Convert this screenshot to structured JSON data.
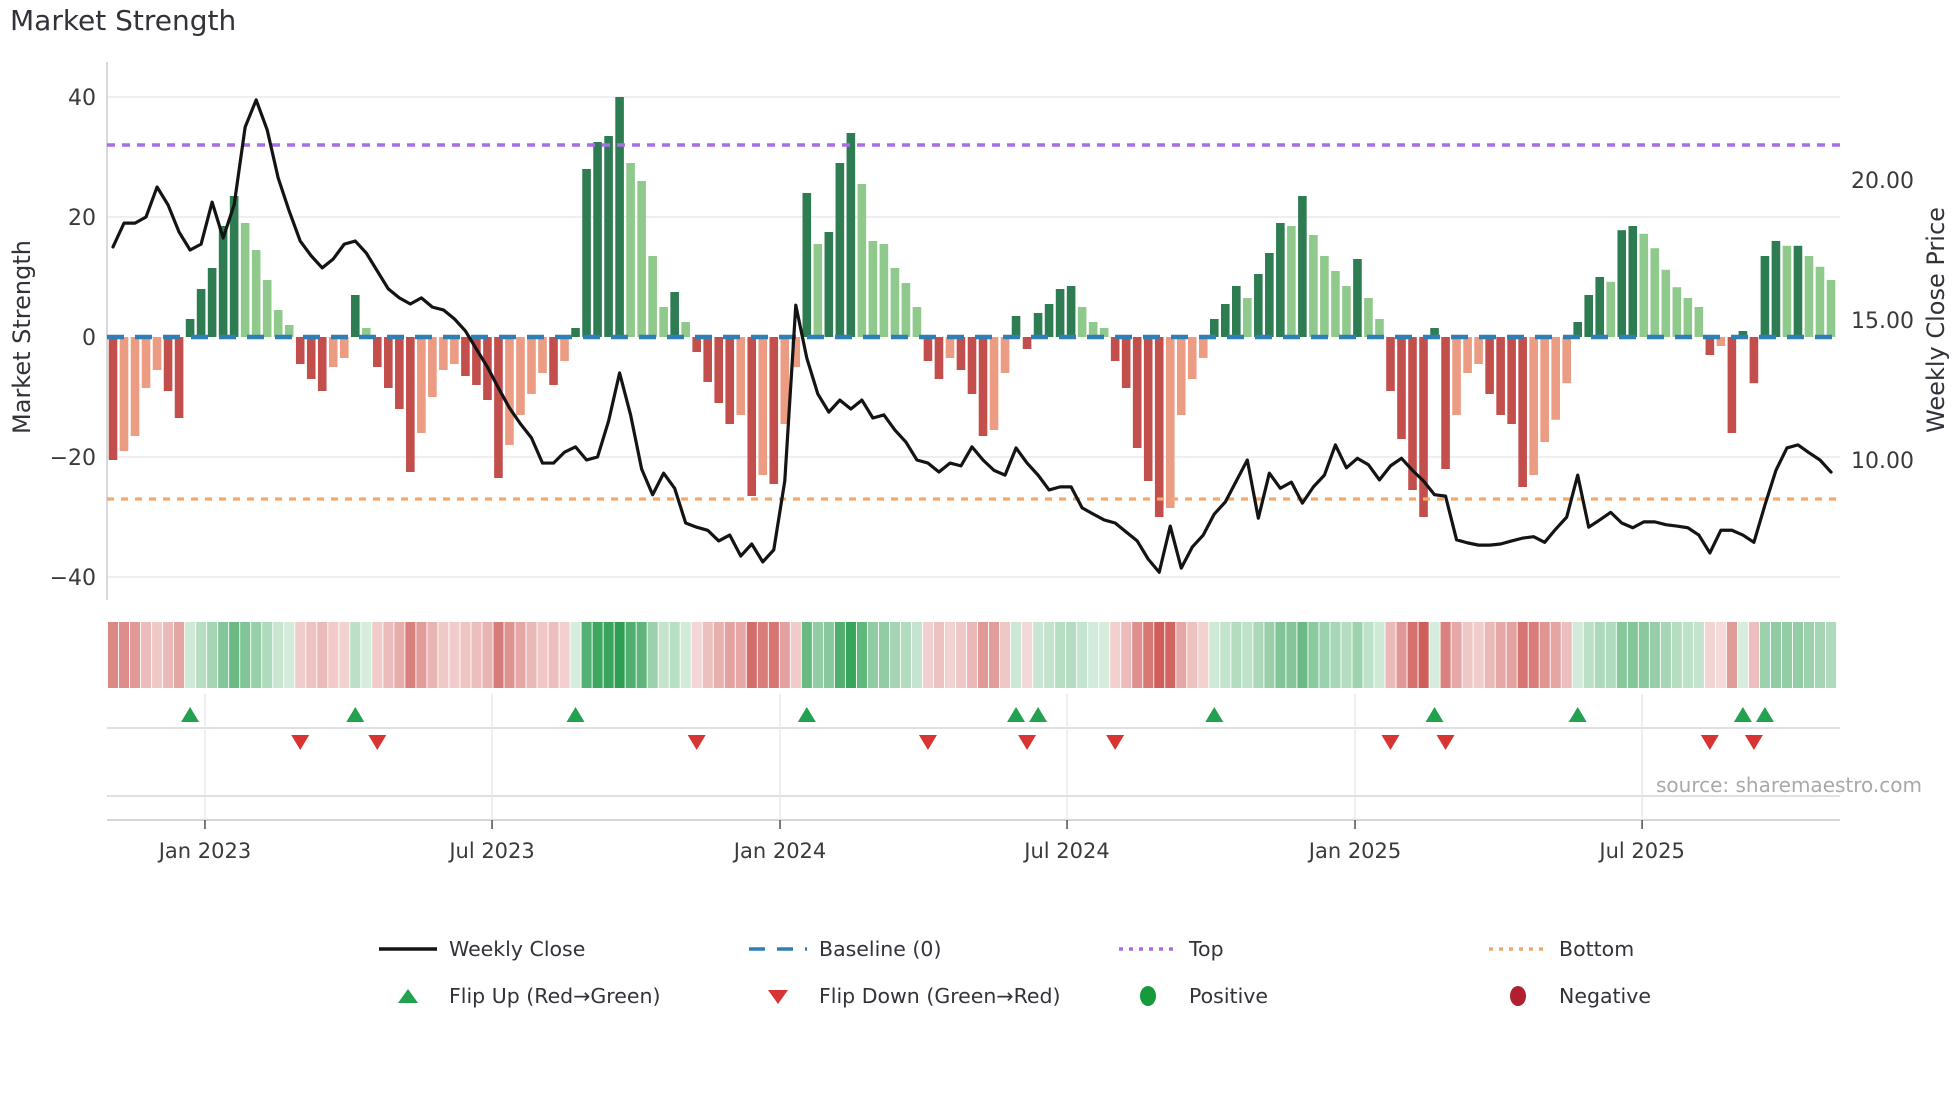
{
  "title": "Market Strength",
  "source_text": "source: sharemaestro.com",
  "axes": {
    "left_label": "Market Strength",
    "right_label": "Weekly Close Price",
    "left_ticks": [
      {
        "label": "40",
        "v": 40
      },
      {
        "label": "20",
        "v": 20
      },
      {
        "label": "0",
        "v": 0
      },
      {
        "label": "−20",
        "v": -20
      },
      {
        "label": "−40",
        "v": -40
      }
    ],
    "right_ticks": [
      {
        "label": "20.00",
        "p": 20
      },
      {
        "label": "15.00",
        "p": 15
      },
      {
        "label": "10.00",
        "p": 10
      }
    ],
    "x_ticks": [
      {
        "label": "Jan 2023",
        "week": 8.35
      },
      {
        "label": "Jul 2023",
        "week": 34.42
      },
      {
        "label": "Jan 2024",
        "week": 60.57
      },
      {
        "label": "Jul 2024",
        "week": 86.63
      },
      {
        "label": "Jan 2025",
        "week": 112.78
      },
      {
        "label": "Jul 2025",
        "week": 138.85
      }
    ]
  },
  "legend": {
    "weekly_close": "Weekly Close",
    "baseline": "Baseline (0)",
    "top": "Top",
    "bottom": "Bottom",
    "flip_up": "Flip Up (Red→Green)",
    "flip_down": "Flip Down (Green→Red)",
    "positive": "Positive",
    "negative": "Negative"
  },
  "colors": {
    "bar_pos_strong": "#2e7d52",
    "bar_pos_weak": "#90c98c",
    "bar_neg_strong": "#c34f4d",
    "bar_neg_weak": "#eb9c82",
    "baseline_blue": "#2d7fb5",
    "top_purple": "#a86ee6",
    "bottom_orange": "#f4a968",
    "line_black": "#141414",
    "flip_up_green": "#22a14f",
    "flip_down_red": "#d93434",
    "positive_dot": "#169a3c",
    "negative_dot": "#b02030",
    "grid": "#e9e9f0",
    "spine": "#cfcfd6",
    "tick_text": "#3a3a3a",
    "source_gray": "#a9a9ad",
    "heat_pos": "#2e9e53",
    "heat_neg": "#c74440"
  },
  "chart_data": {
    "type": "bar",
    "weeks": 157,
    "baseline": 0,
    "top_threshold": 32,
    "bottom_threshold": -27,
    "left_ylim": [
      -44,
      46
    ],
    "right_ylim": [
      5.2,
      22.9
    ],
    "grid_values": [
      40,
      20,
      -20,
      -40
    ],
    "series": [
      {
        "name": "Market Strength",
        "type": "bar",
        "axis": "left",
        "values": [
          -20.5,
          -19,
          -16.5,
          -8.5,
          -5.5,
          -9,
          -13.5,
          3,
          8,
          11.5,
          18.5,
          23.5,
          19,
          14.5,
          9.5,
          4.5,
          2,
          -4.5,
          -7,
          -9,
          -5,
          -3.5,
          7,
          1.5,
          -5,
          -8.5,
          -12,
          -22.5,
          -16,
          -10,
          -5.5,
          -4.5,
          -6.5,
          -8,
          -10.5,
          -23.5,
          -18,
          -13,
          -9.5,
          -6,
          -8,
          -4,
          1.5,
          28,
          32.5,
          33.5,
          40,
          29,
          26,
          13.5,
          5,
          7.5,
          2.5,
          -2.5,
          -7.5,
          -11,
          -14.5,
          -13,
          -26.5,
          -23,
          -24.5,
          -14.5,
          -5,
          24,
          15.5,
          17.5,
          29,
          34,
          25.5,
          16,
          15.5,
          11.5,
          9,
          5,
          -4,
          -7,
          -3.5,
          -5.5,
          -9.5,
          -16.5,
          -15.5,
          -6,
          3.5,
          -2,
          4,
          5.5,
          8,
          8.5,
          5,
          2.5,
          1.5,
          -4,
          -8.5,
          -18.5,
          -24,
          -30,
          -28.5,
          -13,
          -7,
          -3.5,
          3,
          5.5,
          8.5,
          6.5,
          10.5,
          14,
          19,
          18.5,
          23.5,
          17,
          13.5,
          11,
          8.5,
          13,
          6.5,
          3,
          -9,
          -17,
          -25.5,
          -30,
          1.5,
          -22,
          -13,
          -6,
          -4.5,
          -9.5,
          -13,
          -14.5,
          -25,
          -23,
          -17.5,
          -13.8,
          -7.7,
          2.5,
          7,
          10,
          9.2,
          17.8,
          18.5,
          17.2,
          14.8,
          11.2,
          8.3,
          6.5,
          5,
          -3,
          -1.5,
          -16,
          1,
          -7.7,
          13.5,
          16,
          15.2,
          15.2,
          13.5,
          11.7,
          9.5
        ]
      },
      {
        "name": "Weekly Close",
        "type": "line",
        "axis": "right",
        "values": [
          17.61,
          18.46,
          18.46,
          18.68,
          19.75,
          19.11,
          18.14,
          17.5,
          17.71,
          19.21,
          17.93,
          19.11,
          21.89,
          22.86,
          21.79,
          20.07,
          18.89,
          17.82,
          17.29,
          16.86,
          17.18,
          17.71,
          17.82,
          17.39,
          16.75,
          16.11,
          15.79,
          15.57,
          15.79,
          15.46,
          15.36,
          15.04,
          14.61,
          13.96,
          13.32,
          12.57,
          11.86,
          11.29,
          10.79,
          9.89,
          9.89,
          10.28,
          10.47,
          10.0,
          10.11,
          11.39,
          13.11,
          11.61,
          9.68,
          8.76,
          9.53,
          8.99,
          7.75,
          7.6,
          7.49,
          7.11,
          7.32,
          6.57,
          7.0,
          6.36,
          6.79,
          9.25,
          15.53,
          13.64,
          12.36,
          11.71,
          12.14,
          11.82,
          12.14,
          11.5,
          11.61,
          11.07,
          10.64,
          10.0,
          9.89,
          9.57,
          9.89,
          9.79,
          10.47,
          10.0,
          9.63,
          9.46,
          10.43,
          9.89,
          9.46,
          8.93,
          9.04,
          9.04,
          8.29,
          8.07,
          7.86,
          7.75,
          7.43,
          7.11,
          6.46,
          5.99,
          7.64,
          6.14,
          6.89,
          7.32,
          8.07,
          8.5,
          9.25,
          10.0,
          7.92,
          9.53,
          8.99,
          9.21,
          8.46,
          9.04,
          9.46,
          10.54,
          9.72,
          10.06,
          9.83,
          9.29,
          9.79,
          10.06,
          9.63,
          9.25,
          8.76,
          8.71,
          7.15,
          7.04,
          6.96,
          6.96,
          7.0,
          7.11,
          7.21,
          7.26,
          7.06,
          7.53,
          7.96,
          9.46,
          7.6,
          7.86,
          8.13,
          7.75,
          7.58,
          7.79,
          7.79,
          7.69,
          7.64,
          7.58,
          7.32,
          6.68,
          7.49,
          7.49,
          7.32,
          7.06,
          8.39,
          9.63,
          10.43,
          10.54,
          10.26,
          10.0,
          9.57
        ]
      }
    ],
    "flip_up_weeks": [
      7,
      22,
      42,
      63,
      82,
      84,
      100,
      120,
      133,
      148,
      150
    ],
    "flip_down_weeks": [
      17,
      24,
      53,
      74,
      83,
      91,
      116,
      121,
      145,
      149
    ],
    "heatmap": "same weekly bar values rendered as color intensity strip"
  }
}
